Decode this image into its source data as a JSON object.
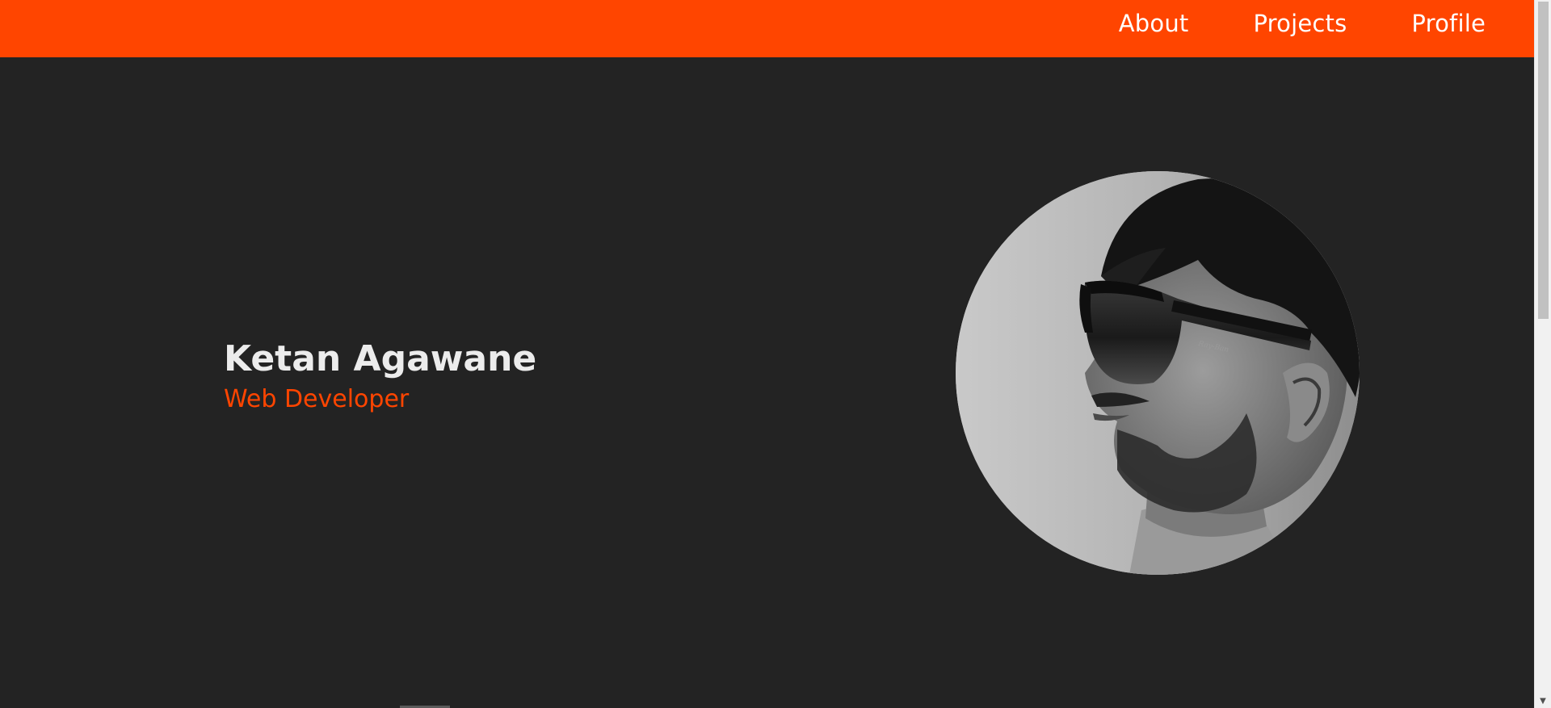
{
  "nav": {
    "links": [
      {
        "label": "About"
      },
      {
        "label": "Projects"
      },
      {
        "label": "Profile"
      }
    ]
  },
  "hero": {
    "name": "Ketan Agawane",
    "role": "Web Developer"
  },
  "colors": {
    "accent": "#ff4500",
    "background": "#232323",
    "name_text": "#ececec"
  },
  "icons": {
    "scroll_down": "chevron-down-icon"
  }
}
